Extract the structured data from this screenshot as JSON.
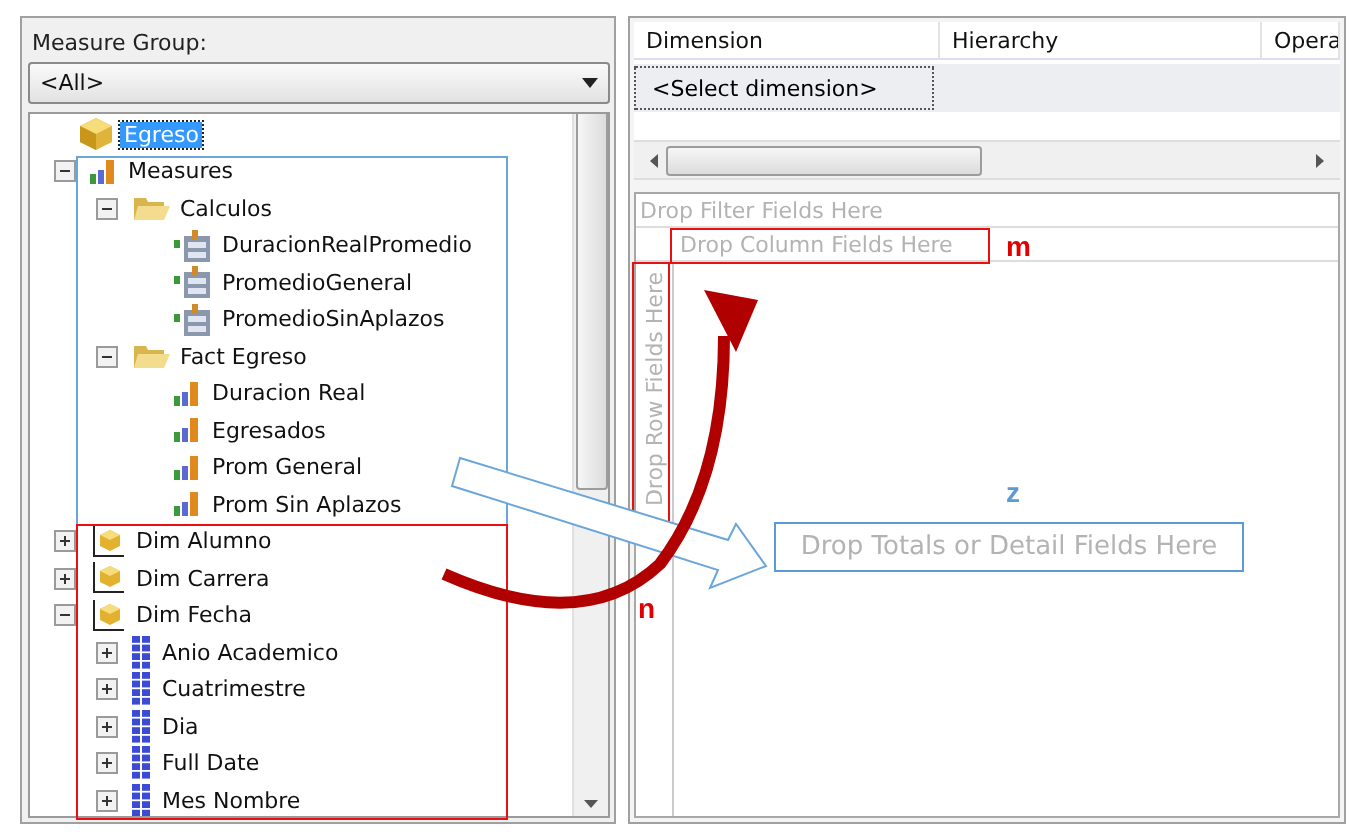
{
  "measure_group": {
    "label": "Measure Group:",
    "value": "<All>"
  },
  "tree": [
    {
      "label": "Egreso",
      "kind": "cube",
      "selected": true,
      "children": [
        {
          "label": "Measures",
          "kind": "measures",
          "expanded": true,
          "selected": false,
          "children": [
            {
              "label": "Calculos",
              "kind": "folder",
              "expanded": true,
              "selected": false,
              "children": [
                {
                  "label": "DuracionRealPromedio",
                  "kind": "calc",
                  "selected": false
                },
                {
                  "label": "PromedioGeneral",
                  "kind": "calc",
                  "selected": false
                },
                {
                  "label": "PromedioSinAplazos",
                  "kind": "calc",
                  "selected": false
                }
              ]
            },
            {
              "label": "Fact Egreso",
              "kind": "folder",
              "expanded": true,
              "selected": false,
              "children": [
                {
                  "label": "Duracion Real",
                  "kind": "measure",
                  "selected": false
                },
                {
                  "label": "Egresados",
                  "kind": "measure",
                  "selected": false
                },
                {
                  "label": "Prom General",
                  "kind": "measure",
                  "selected": false
                },
                {
                  "label": "Prom Sin Aplazos",
                  "kind": "measure",
                  "selected": false
                }
              ]
            }
          ]
        },
        {
          "label": "Dim Alumno",
          "kind": "dimension",
          "expanded": false,
          "selected": false
        },
        {
          "label": "Dim Carrera",
          "kind": "dimension",
          "expanded": false,
          "selected": false
        },
        {
          "label": "Dim Fecha",
          "kind": "dimension",
          "expanded": true,
          "selected": false,
          "children": [
            {
              "label": "Anio Academico",
              "kind": "attribute",
              "expanded": false,
              "selected": false
            },
            {
              "label": "Cuatrimestre",
              "kind": "attribute",
              "expanded": false,
              "selected": false
            },
            {
              "label": "Dia",
              "kind": "attribute",
              "expanded": false,
              "selected": false
            },
            {
              "label": "Full Date",
              "kind": "attribute",
              "expanded": false,
              "selected": false
            },
            {
              "label": "Mes Nombre",
              "kind": "attribute",
              "expanded": false,
              "selected": false
            }
          ]
        }
      ]
    }
  ],
  "filter_grid": {
    "columns": [
      "Dimension",
      "Hierarchy",
      "Opera"
    ],
    "rows": [
      [
        "<Select dimension>"
      ]
    ]
  },
  "pivot": {
    "filter_zone": "Drop Filter Fields Here",
    "column_zone": "Drop Column Fields Here",
    "row_zone": "Drop Row Fields Here",
    "data_zone": "Drop Totals or Detail Fields Here"
  },
  "annotations": [
    {
      "text": "m",
      "color": "#e00000"
    },
    {
      "text": "n",
      "color": "#e00000"
    },
    {
      "text": "z",
      "color": "#5b9bd5"
    }
  ]
}
